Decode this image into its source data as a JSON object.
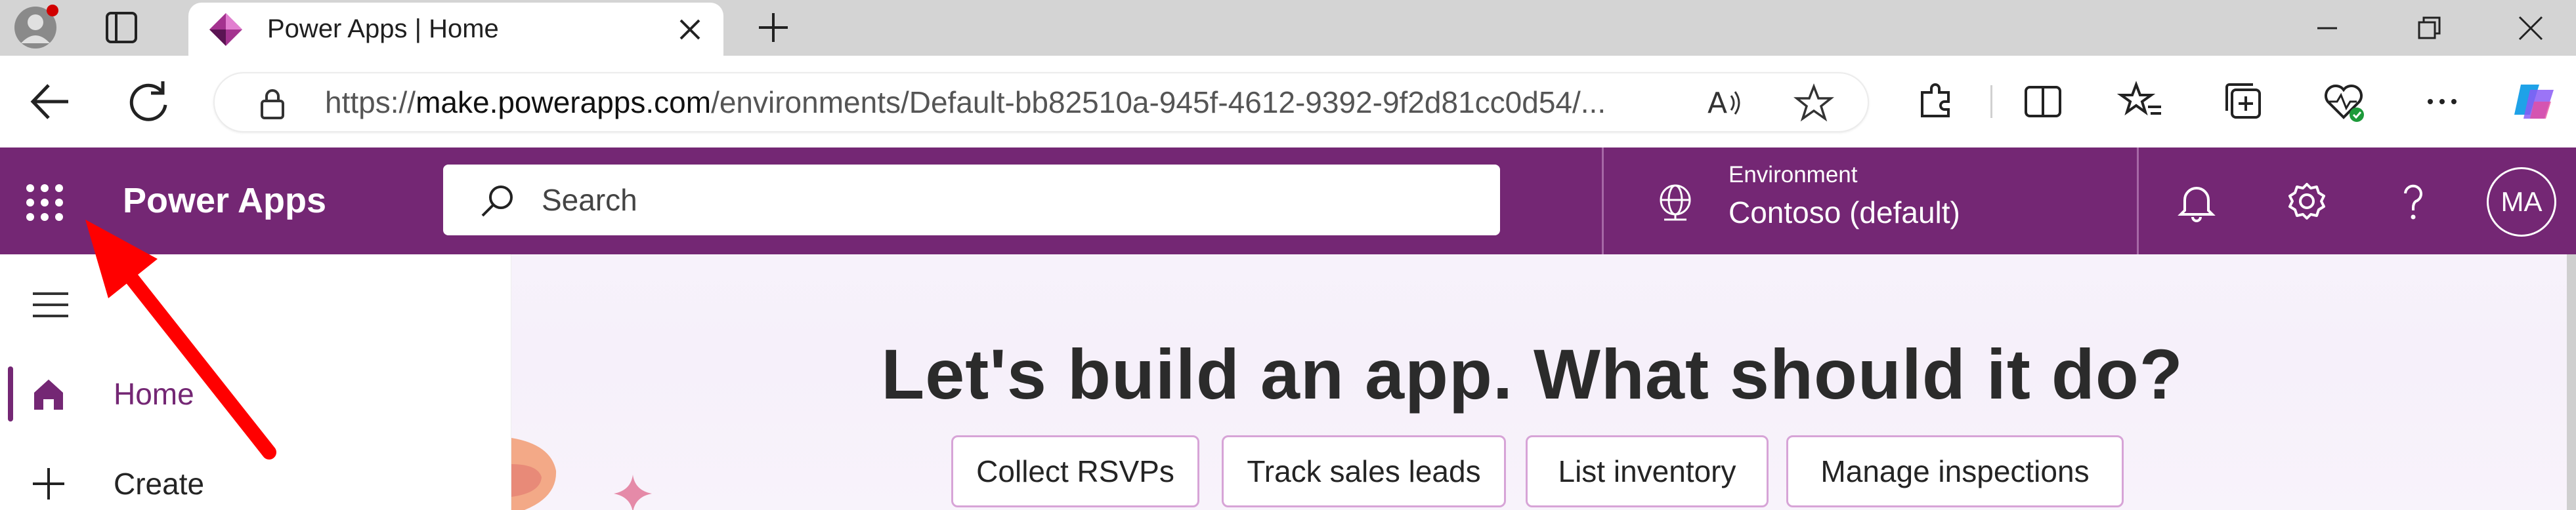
{
  "browser": {
    "tab": {
      "title": "Power Apps | Home"
    },
    "address": {
      "url_prefix": "https://",
      "url_host": "make.powerapps.com",
      "url_path": "/environments/Default-bb82510a-945f-4612-9392-9f2d81cc0d54/..."
    },
    "icons": {
      "profile": "profile-icon",
      "tab_actions": "tab-actions-icon",
      "close_tab": "close-icon",
      "new_tab": "plus-icon",
      "minimize": "minimize-icon",
      "restore": "restore-icon",
      "close_window": "close-icon",
      "back": "back-arrow-icon",
      "refresh": "refresh-icon",
      "lock": "lock-icon",
      "read_aloud": "read-aloud-icon",
      "favorite": "star-icon",
      "extensions": "puzzle-icon",
      "split_screen": "split-screen-icon",
      "favorites": "favorites-icon",
      "collections": "collections-icon",
      "browser_essentials": "heart-pulse-icon",
      "more": "more-icon",
      "copilot": "copilot-icon"
    }
  },
  "header": {
    "app_name": "Power Apps",
    "search_placeholder": "Search",
    "environment_label": "Environment",
    "environment_value": "Contoso (default)",
    "avatar_initials": "MA",
    "accent": "#742774"
  },
  "leftnav": {
    "items": [
      {
        "label": "Home",
        "icon": "home-icon",
        "selected": true
      },
      {
        "label": "Create",
        "icon": "plus-icon",
        "selected": false
      }
    ]
  },
  "main": {
    "hero_title": "Let's build an app. What should it do?",
    "suggestions": [
      {
        "label": "Collect RSVPs"
      },
      {
        "label": "Track sales leads"
      },
      {
        "label": "List inventory"
      },
      {
        "label": "Manage inspections"
      }
    ]
  },
  "annotation": {
    "arrow_color": "#ff0000"
  }
}
